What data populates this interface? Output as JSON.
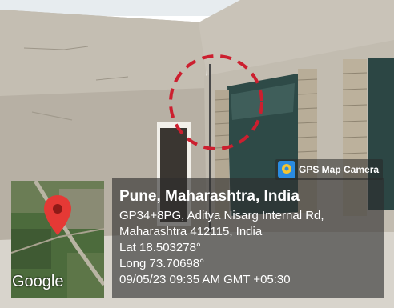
{
  "stamp": {
    "city": "Pune, Maharashtra, India",
    "address_line_1": "GP34+8PG, Aditya Nisarg Internal Rd,",
    "address_line_2": "Maharashtra 412115, India",
    "latitude": "Lat 18.503278°",
    "longitude": "Long 73.70698°",
    "timestamp": "09/05/23 09:35 AM GMT +05:30"
  },
  "app_badge": {
    "name": "GPS Map Camera"
  },
  "map_thumbnail": {
    "attribution": "Google",
    "pin_icon": "map-pin-icon"
  },
  "colors": {
    "pin": "#e53935",
    "annotation_circle": "#cc1f2f",
    "overlay": "#2d2d2d"
  }
}
